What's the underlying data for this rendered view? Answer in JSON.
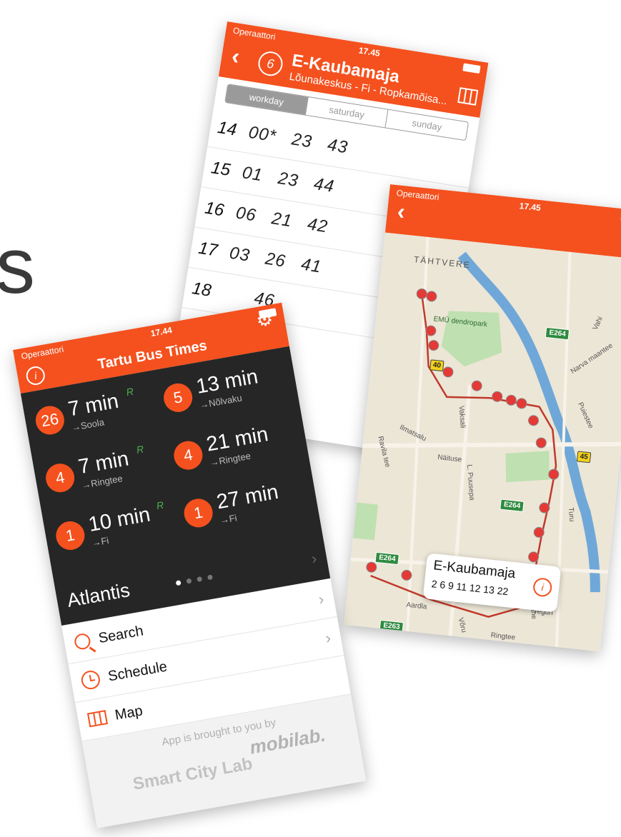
{
  "background_text": "s",
  "colors": {
    "accent": "#f4511e",
    "dark_panel": "#262626",
    "r_badge": "#4caf50"
  },
  "schedule_screen": {
    "status": {
      "carrier": "Operaattori",
      "time": "17.45"
    },
    "back_icon": "chevron-left-icon",
    "route_number": "6",
    "title": "E-Kaubamaja",
    "subtitle": "Lõunakeskus - Fi - Ropkamõisa...",
    "tabs": [
      "workday",
      "saturday",
      "sunday"
    ],
    "rows": [
      {
        "hour": "14",
        "minutes": [
          "00*",
          "23",
          "43"
        ]
      },
      {
        "hour": "15",
        "minutes": [
          "01",
          "23",
          "44"
        ]
      },
      {
        "hour": "16",
        "minutes": [
          "06",
          "21",
          "42"
        ]
      },
      {
        "hour": "17",
        "minutes": [
          "03",
          "26",
          "41"
        ]
      },
      {
        "hour": "18",
        "minutes": [
          "",
          "",
          "46"
        ]
      }
    ]
  },
  "map_screen": {
    "status": {
      "carrier": "Operaattori",
      "time": "17.45"
    },
    "labels": {
      "tahtvere": "TÄHTVERE",
      "dendropark": "EMÜ dendropark",
      "vaksali": "Vaksali",
      "ilmatsalu": "Ilmatsalu",
      "naituse": "Näituse",
      "ravila": "Ravila tee",
      "pusepa": "L. Puusepa",
      "narva": "Narva maantee",
      "puiestee": "Puiestee",
      "vahi": "Vahi",
      "aardla": "Aardla",
      "voru": "Võru",
      "ringtee": "Ringtee",
      "teguri": "Teguri",
      "turu": "Turu",
      "tahe": "Tähe"
    },
    "shields": {
      "e264a": "E264",
      "e264b": "E264",
      "e264c": "E264",
      "e263": "E263",
      "r40": "40",
      "r45": "45"
    },
    "callout": {
      "title": "E-Kaubamaja",
      "routes": "2 6 9 11 12 13 22"
    }
  },
  "home_screen": {
    "status": {
      "carrier": "Operaattori",
      "time": "17.44"
    },
    "title": "Tartu Bus Times",
    "departures": [
      {
        "route": "26",
        "time": "7 min",
        "realtime": "R",
        "direction": "→Soola"
      },
      {
        "route": "5",
        "time": "13 min",
        "realtime": "",
        "direction": "→Nõlvaku"
      },
      {
        "route": "4",
        "time": "7 min",
        "realtime": "R",
        "direction": "→Ringtee"
      },
      {
        "route": "4",
        "time": "21 min",
        "realtime": "",
        "direction": "→Ringtee"
      },
      {
        "route": "1",
        "time": "10 min",
        "realtime": "R",
        "direction": "→Fi"
      },
      {
        "route": "1",
        "time": "27 min",
        "realtime": "",
        "direction": "→Fi"
      }
    ],
    "stop_name": "Atlantis",
    "menu": [
      {
        "label": "Search",
        "icon": "search-icon"
      },
      {
        "label": "Schedule",
        "icon": "clock-icon"
      },
      {
        "label": "Map",
        "icon": "map-icon"
      }
    ],
    "footer": {
      "brought_by": "App is brought to you by",
      "brand1": "mobilab.",
      "brand2": "Smart City Lab"
    }
  }
}
